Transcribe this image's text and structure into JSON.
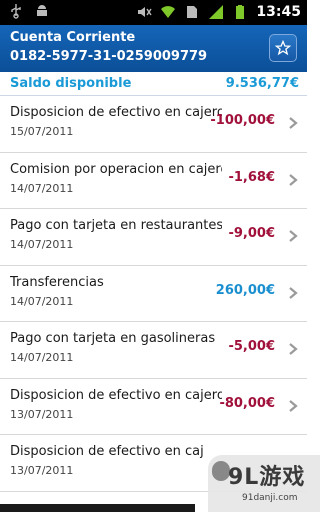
{
  "statusbar": {
    "time": "13:45",
    "icons": [
      "usb-icon",
      "android-icon",
      "mute-icon",
      "wifi-icon",
      "sim-icon",
      "signal-icon",
      "battery-icon"
    ]
  },
  "header": {
    "title": "Cuenta Corriente",
    "account": "0182-5977-31-0259009779",
    "favorite_icon": "star-icon"
  },
  "balance": {
    "label": "Saldo disponible",
    "value": "9.536,77€"
  },
  "transactions": [
    {
      "title": "Disposicion de efectivo en cajero",
      "date": "15/07/2011",
      "amount": "-100,00€",
      "kind": "neg"
    },
    {
      "title": "Comision por operacion en cajero",
      "date": "14/07/2011",
      "amount": "-1,68€",
      "kind": "neg"
    },
    {
      "title": "Pago con tarjeta en restaurantes",
      "date": "14/07/2011",
      "amount": "-9,00€",
      "kind": "neg"
    },
    {
      "title": "Transferencias",
      "date": "14/07/2011",
      "amount": "260,00€",
      "kind": "pos"
    },
    {
      "title": "Pago con tarjeta en gasolineras",
      "date": "14/07/2011",
      "amount": "-5,00€",
      "kind": "neg"
    },
    {
      "title": "Disposicion de efectivo en cajero",
      "date": "13/07/2011",
      "amount": "-80,00€",
      "kind": "neg"
    },
    {
      "title": "Disposicion de efectivo en caj",
      "date": "13/07/2011",
      "amount": "",
      "kind": "neg"
    }
  ],
  "watermark": {
    "brand": "9L游戏",
    "site": "91danji.com"
  },
  "colors": {
    "appbar": "#0b4f98",
    "accent_blue": "#1a9ad6",
    "negative": "#a0103a",
    "positive": "#1a8fd0"
  }
}
